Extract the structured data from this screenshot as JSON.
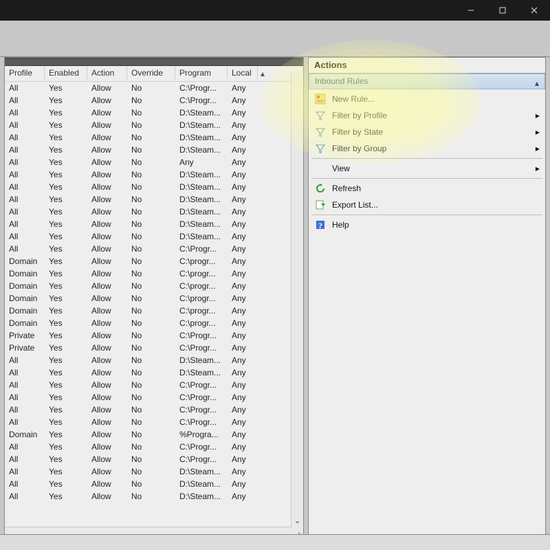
{
  "titlebar": {
    "minimize": "–",
    "maximize": "☐",
    "close": "✕"
  },
  "grid": {
    "headers": [
      "Profile",
      "Enabled",
      "Action",
      "Override",
      "Program",
      "Local"
    ],
    "scroll_up": "▴",
    "scroll_down": "⌄",
    "scroll_right": "›",
    "rows": [
      {
        "profile": "All",
        "enabled": "Yes",
        "action": "Allow",
        "override": "No",
        "program": "C:\\Progr...",
        "local": "Any"
      },
      {
        "profile": "All",
        "enabled": "Yes",
        "action": "Allow",
        "override": "No",
        "program": "C:\\Progr...",
        "local": "Any"
      },
      {
        "profile": "All",
        "enabled": "Yes",
        "action": "Allow",
        "override": "No",
        "program": "D:\\Steam...",
        "local": "Any"
      },
      {
        "profile": "All",
        "enabled": "Yes",
        "action": "Allow",
        "override": "No",
        "program": "D:\\Steam...",
        "local": "Any"
      },
      {
        "profile": "All",
        "enabled": "Yes",
        "action": "Allow",
        "override": "No",
        "program": "D:\\Steam...",
        "local": "Any"
      },
      {
        "profile": "All",
        "enabled": "Yes",
        "action": "Allow",
        "override": "No",
        "program": "D:\\Steam...",
        "local": "Any"
      },
      {
        "profile": "All",
        "enabled": "Yes",
        "action": "Allow",
        "override": "No",
        "program": "Any",
        "local": "Any"
      },
      {
        "profile": "All",
        "enabled": "Yes",
        "action": "Allow",
        "override": "No",
        "program": "D:\\Steam...",
        "local": "Any"
      },
      {
        "profile": "All",
        "enabled": "Yes",
        "action": "Allow",
        "override": "No",
        "program": "D:\\Steam...",
        "local": "Any"
      },
      {
        "profile": "All",
        "enabled": "Yes",
        "action": "Allow",
        "override": "No",
        "program": "D:\\Steam...",
        "local": "Any"
      },
      {
        "profile": "All",
        "enabled": "Yes",
        "action": "Allow",
        "override": "No",
        "program": "D:\\Steam...",
        "local": "Any"
      },
      {
        "profile": "All",
        "enabled": "Yes",
        "action": "Allow",
        "override": "No",
        "program": "D:\\Steam...",
        "local": "Any"
      },
      {
        "profile": "All",
        "enabled": "Yes",
        "action": "Allow",
        "override": "No",
        "program": "D:\\Steam...",
        "local": "Any"
      },
      {
        "profile": "All",
        "enabled": "Yes",
        "action": "Allow",
        "override": "No",
        "program": "C:\\Progr...",
        "local": "Any"
      },
      {
        "profile": "Domain",
        "enabled": "Yes",
        "action": "Allow",
        "override": "No",
        "program": "C:\\progr...",
        "local": "Any"
      },
      {
        "profile": "Domain",
        "enabled": "Yes",
        "action": "Allow",
        "override": "No",
        "program": "C:\\progr...",
        "local": "Any"
      },
      {
        "profile": "Domain",
        "enabled": "Yes",
        "action": "Allow",
        "override": "No",
        "program": "C:\\progr...",
        "local": "Any"
      },
      {
        "profile": "Domain",
        "enabled": "Yes",
        "action": "Allow",
        "override": "No",
        "program": "C:\\progr...",
        "local": "Any"
      },
      {
        "profile": "Domain",
        "enabled": "Yes",
        "action": "Allow",
        "override": "No",
        "program": "C:\\progr...",
        "local": "Any"
      },
      {
        "profile": "Domain",
        "enabled": "Yes",
        "action": "Allow",
        "override": "No",
        "program": "C:\\progr...",
        "local": "Any"
      },
      {
        "profile": "Private",
        "enabled": "Yes",
        "action": "Allow",
        "override": "No",
        "program": "C:\\Progr...",
        "local": "Any"
      },
      {
        "profile": "Private",
        "enabled": "Yes",
        "action": "Allow",
        "override": "No",
        "program": "C:\\Progr...",
        "local": "Any"
      },
      {
        "profile": "All",
        "enabled": "Yes",
        "action": "Allow",
        "override": "No",
        "program": "D:\\Steam...",
        "local": "Any"
      },
      {
        "profile": "All",
        "enabled": "Yes",
        "action": "Allow",
        "override": "No",
        "program": "D:\\Steam...",
        "local": "Any"
      },
      {
        "profile": "All",
        "enabled": "Yes",
        "action": "Allow",
        "override": "No",
        "program": "C:\\Progr...",
        "local": "Any"
      },
      {
        "profile": "All",
        "enabled": "Yes",
        "action": "Allow",
        "override": "No",
        "program": "C:\\Progr...",
        "local": "Any"
      },
      {
        "profile": "All",
        "enabled": "Yes",
        "action": "Allow",
        "override": "No",
        "program": "C:\\Progr...",
        "local": "Any"
      },
      {
        "profile": "All",
        "enabled": "Yes",
        "action": "Allow",
        "override": "No",
        "program": "C:\\Progr...",
        "local": "Any"
      },
      {
        "profile": "Domain",
        "enabled": "Yes",
        "action": "Allow",
        "override": "No",
        "program": "%Progra...",
        "local": "Any"
      },
      {
        "profile": "All",
        "enabled": "Yes",
        "action": "Allow",
        "override": "No",
        "program": "C:\\Progr...",
        "local": "Any"
      },
      {
        "profile": "All",
        "enabled": "Yes",
        "action": "Allow",
        "override": "No",
        "program": "C:\\Progr...",
        "local": "Any"
      },
      {
        "profile": "All",
        "enabled": "Yes",
        "action": "Allow",
        "override": "No",
        "program": "D:\\Steam...",
        "local": "Any"
      },
      {
        "profile": "All",
        "enabled": "Yes",
        "action": "Allow",
        "override": "No",
        "program": "D:\\Steam...",
        "local": "Any"
      },
      {
        "profile": "All",
        "enabled": "Yes",
        "action": "Allow",
        "override": "No",
        "program": "D:\\Steam...",
        "local": "Any"
      }
    ]
  },
  "actions": {
    "title": "Actions",
    "subtitle": "Inbound Rules",
    "items": [
      {
        "icon": "new-rule",
        "label": "New Rule...",
        "arrow": false
      },
      {
        "icon": "filter",
        "label": "Filter by Profile",
        "arrow": true
      },
      {
        "icon": "filter",
        "label": "Filter by State",
        "arrow": true
      },
      {
        "icon": "filter",
        "label": "Filter by Group",
        "arrow": true
      },
      {
        "sep": true
      },
      {
        "icon": "blank",
        "label": "View",
        "arrow": true
      },
      {
        "sep": true
      },
      {
        "icon": "refresh",
        "label": "Refresh",
        "arrow": false
      },
      {
        "icon": "export",
        "label": "Export List...",
        "arrow": false
      },
      {
        "sep": true
      },
      {
        "icon": "help",
        "label": "Help",
        "arrow": false
      }
    ]
  }
}
